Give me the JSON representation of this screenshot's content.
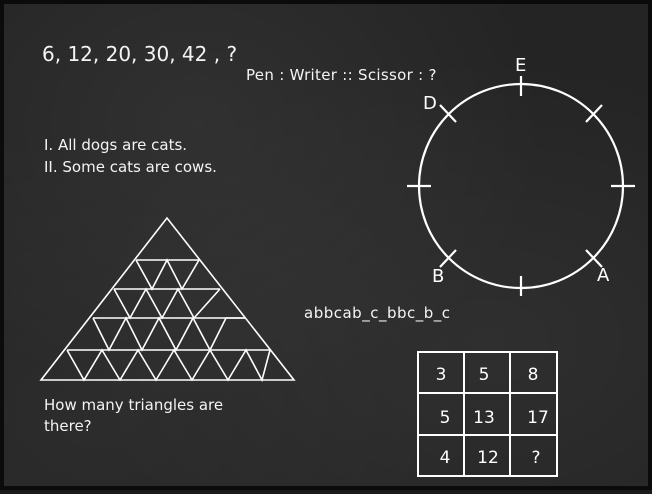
{
  "series_question": "6, 12, 20, 30, 42 , ?",
  "analogy_question": "Pen : Writer :: Scissor : ?",
  "statements": {
    "first": "I.   All dogs are cats.",
    "second": "II. Some cats are cows."
  },
  "triangle_question": {
    "line1": "How many triangles are",
    "line2": "there?"
  },
  "letter_series": "abbcab_c_bbc_b_c",
  "circle_labels": {
    "e": "E",
    "d": "D",
    "b": "B",
    "a": "A"
  },
  "number_grid": [
    [
      "3",
      "5",
      "8"
    ],
    [
      "5",
      "13",
      "17"
    ],
    [
      "4",
      "12",
      "?"
    ]
  ],
  "colors": {
    "board": "#242424",
    "chalk": "#f4f4f4"
  }
}
